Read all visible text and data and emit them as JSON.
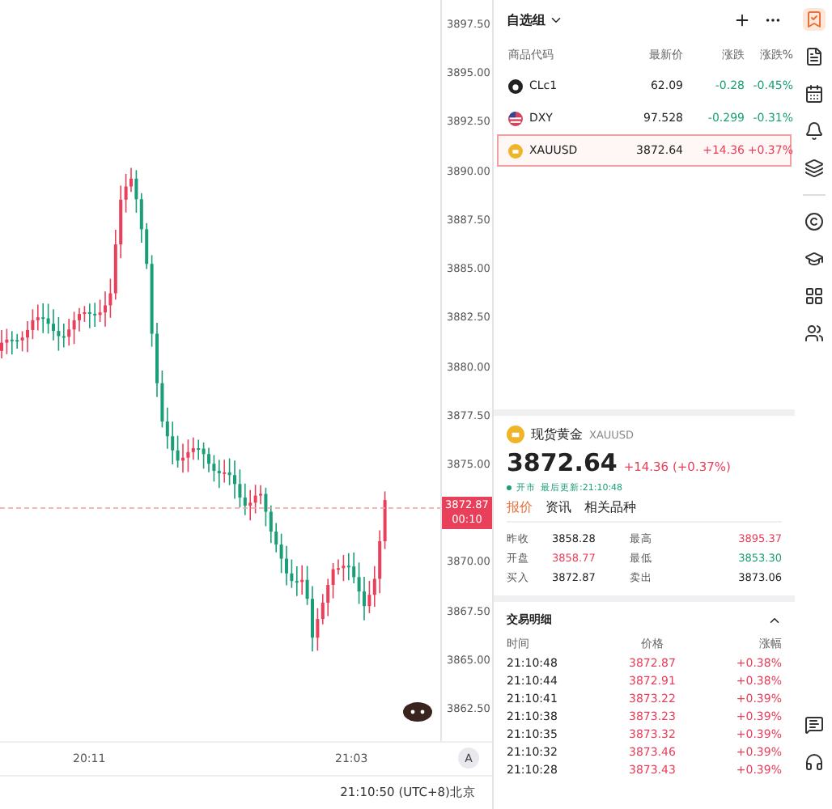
{
  "chart": {
    "price_axis": [
      "3897.50",
      "3895.00",
      "3892.50",
      "3890.00",
      "3887.50",
      "3885.00",
      "3882.50",
      "3880.00",
      "3877.50",
      "3875.00",
      "3870.00",
      "3867.50",
      "3865.00",
      "3862.50"
    ],
    "last_price": {
      "price": "3872.87",
      "countdown": "00:10"
    },
    "time_axis": [
      "20:11",
      "21:03"
    ],
    "scale_button": "A",
    "clock": "21:10:50 (UTC+8)北京"
  },
  "watchlist": {
    "title": "自选组",
    "columns": [
      "商品代码",
      "最新价",
      "涨跌",
      "涨跌%"
    ],
    "rows": [
      {
        "symbol": "CLc1",
        "price": "62.09",
        "change": "-0.28",
        "percent": "-0.45%",
        "selected": false,
        "kind": "oil"
      },
      {
        "symbol": "DXY",
        "price": "97.528",
        "change": "-0.299",
        "percent": "-0.31%",
        "selected": false,
        "kind": "flag"
      },
      {
        "symbol": "XAUUSD",
        "price": "3872.64",
        "change": "+14.36",
        "percent": "+0.37%",
        "selected": true,
        "kind": "gold"
      }
    ]
  },
  "quote": {
    "name": "现货黄金",
    "symbol": "XAUUSD",
    "price": "3872.64",
    "change": "+14.36 (+0.37%)",
    "status": "开市",
    "updated": "最后更新:21:10:48",
    "tabs": [
      {
        "label": "报价",
        "selected": true
      },
      {
        "label": "资讯",
        "selected": false
      },
      {
        "label": "相关品种",
        "selected": false
      }
    ],
    "stats": [
      {
        "label": "昨收",
        "value": "3858.28",
        "color": "#222222"
      },
      {
        "label": "最高",
        "value": "3895.37",
        "color": "#e8405a"
      },
      {
        "label": "开盘",
        "value": "3858.77",
        "color": "#e8405a"
      },
      {
        "label": "最低",
        "value": "3853.30",
        "color": "#1a9e78"
      },
      {
        "label": "买入",
        "value": "3872.87",
        "color": "#222222"
      },
      {
        "label": "卖出",
        "value": "3873.06",
        "color": "#222222"
      }
    ]
  },
  "trades": {
    "title": "交易明细",
    "columns": [
      "时间",
      "价格",
      "涨幅"
    ],
    "rows": [
      {
        "time": "21:10:48",
        "price": "3872.87",
        "percent": "+0.38%"
      },
      {
        "time": "21:10:44",
        "price": "3872.91",
        "percent": "+0.38%"
      },
      {
        "time": "21:10:41",
        "price": "3873.22",
        "percent": "+0.39%"
      },
      {
        "time": "21:10:38",
        "price": "3873.23",
        "percent": "+0.39%"
      },
      {
        "time": "21:10:35",
        "price": "3873.32",
        "percent": "+0.39%"
      },
      {
        "time": "21:10:32",
        "price": "3873.46",
        "percent": "+0.39%"
      },
      {
        "time": "21:10:28",
        "price": "3873.43",
        "percent": "+0.39%"
      }
    ]
  }
}
